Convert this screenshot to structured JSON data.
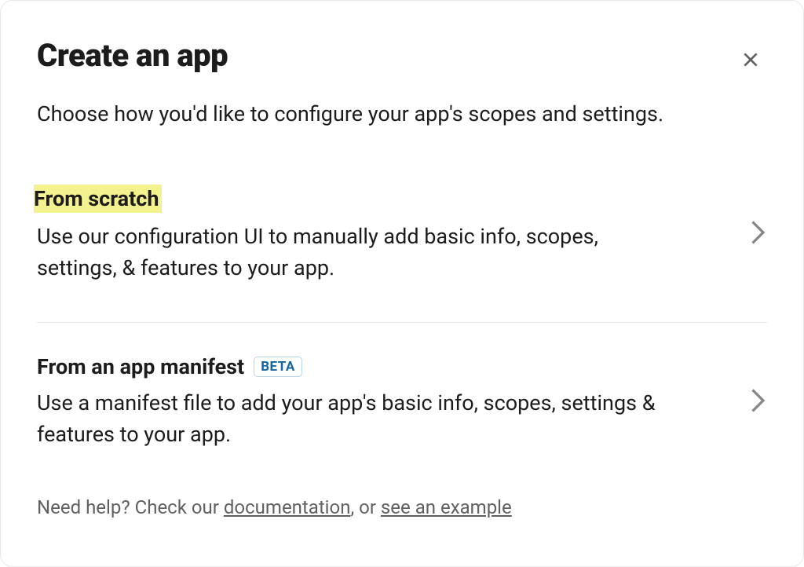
{
  "modal": {
    "title": "Create an app",
    "subtitle": "Choose how you'd like to configure your app's scopes and settings."
  },
  "options": {
    "scratch": {
      "title": "From scratch",
      "description": "Use our configuration UI to manually add basic info, scopes, settings, & features to your app."
    },
    "manifest": {
      "title": "From an app manifest",
      "badge": "BETA",
      "description": "Use a manifest file to add your app's basic info, scopes, settings & features to your app."
    }
  },
  "help": {
    "prefix": "Need help? Check our ",
    "doc_link": "documentation",
    "middle": ", or ",
    "example_link": "see an example"
  }
}
